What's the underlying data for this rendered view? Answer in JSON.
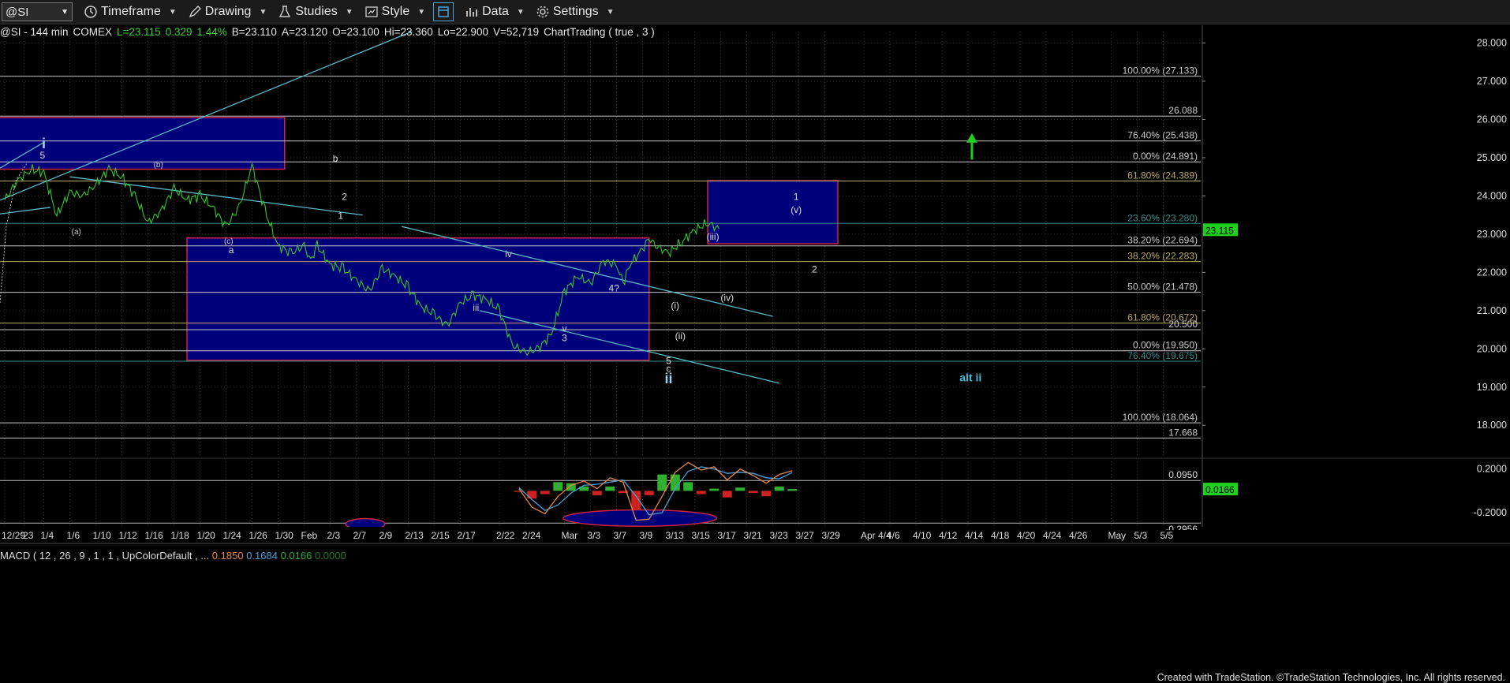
{
  "toolbar": {
    "symbol": "@SI",
    "timeframe": "Timeframe",
    "drawing": "Drawing",
    "studies": "Studies",
    "style": "Style",
    "data": "Data",
    "settings": "Settings"
  },
  "info_line": {
    "symbol": "@SI - 144 min",
    "exchange": "COMEX",
    "last": "L=23.115",
    "change": "0.329",
    "change_pct": "1.44%",
    "bid": "B=23.110",
    "ask": "A=23.120",
    "open": "O=23.100",
    "high": "Hi=23.360",
    "low": "Lo=22.900",
    "volume": "V=52,719",
    "chart_trading": "ChartTrading ( true , 3 )"
  },
  "macd_line": {
    "label": "MACD ( 12 , 26 , 9 , 1 , 1 , UpColorDefault , ...",
    "v1": "0.1850",
    "v2": "0.1684",
    "v3": "0.0166",
    "v4": "0.0000"
  },
  "footer": "Created with TradeStation. ©TradeStation Technologies, Inc. All rights reserved.",
  "colors": {
    "price": "#35c62f",
    "fib_gray": "#c8c8c8",
    "fib_olive": "#b9a86a",
    "box_fill": "#00007a",
    "box_border": "#cc2244",
    "channel": "#5ab8c8",
    "macd_orange": "#e4864a",
    "macd_blue": "#4aa0d8",
    "hist_green": "#30b030",
    "hist_red": "#cc2222",
    "accent_green": "#22cc22"
  },
  "chart_data": {
    "type": "line",
    "title": "@SI - 144 min COMEX",
    "price_axis": {
      "ylim": [
        17.2,
        28.3
      ],
      "ticks": [
        "28.000",
        "27.000",
        "26.000",
        "25.000",
        "24.000",
        "23.000",
        "22.000",
        "21.000",
        "20.000",
        "19.000",
        "18.000"
      ],
      "last_price_label": "23.115"
    },
    "x_axis": {
      "ticks": [
        "12/29",
        "'23",
        "1/4",
        "1/6",
        "1/10",
        "1/12",
        "1/16",
        "1/18",
        "1/20",
        "1/24",
        "1/26",
        "1/30",
        "Feb",
        "2/3",
        "2/7",
        "2/9",
        "2/13",
        "2/15",
        "2/17",
        "2/22",
        "2/24",
        "Mar",
        "3/3",
        "3/7",
        "3/9",
        "3/13",
        "3/15",
        "3/17",
        "3/21",
        "3/23",
        "3/27",
        "3/29",
        "Apr 4/4",
        "4/6",
        "4/10",
        "4/12",
        "4/14",
        "4/18",
        "4/20",
        "4/24",
        "4/26",
        "May",
        "5/3",
        "5/5"
      ],
      "tick_index": [
        0,
        1.5,
        3,
        5,
        7,
        9,
        11,
        13,
        15,
        17,
        19,
        21,
        23,
        25,
        27,
        29,
        31,
        33,
        35,
        38,
        40,
        43,
        45,
        47,
        49,
        51,
        53,
        55,
        57,
        59,
        61,
        63,
        66,
        68,
        70,
        72,
        74,
        76,
        78,
        80,
        82,
        85,
        87,
        89
      ]
    },
    "price_series": {
      "name": "@SI",
      "x": [
        0,
        1,
        2,
        3,
        4,
        5,
        6,
        7,
        8,
        9,
        10,
        11,
        12,
        13,
        14,
        15,
        16,
        17,
        18,
        19,
        20,
        21,
        22,
        23,
        23.5,
        24,
        25,
        26,
        27,
        28,
        29,
        30,
        31,
        32,
        33,
        34,
        35,
        36,
        37,
        38,
        39,
        40,
        41,
        42,
        43,
        44,
        45,
        46,
        47,
        47.5,
        48,
        49,
        49.5,
        50,
        51,
        52,
        53,
        54,
        55,
        56,
        57,
        58,
        59,
        59.5
      ],
      "y": [
        23.9,
        24.4,
        24.7,
        24.6,
        23.5,
        24.1,
        24.0,
        24.3,
        24.7,
        24.5,
        24.0,
        23.3,
        23.6,
        24.2,
        23.9,
        24.0,
        23.7,
        23.2,
        23.7,
        24.8,
        23.6,
        22.7,
        22.5,
        22.7,
        22.3,
        22.7,
        22.2,
        22.1,
        21.8,
        21.5,
        22.1,
        21.9,
        21.6,
        21.1,
        20.9,
        20.6,
        21.2,
        21.4,
        21.3,
        21.0,
        20.1,
        19.9,
        20.0,
        20.4,
        21.5,
        21.9,
        21.7,
        22.3,
        22.2,
        21.7,
        22.2,
        22.6,
        22.9,
        22.7,
        22.5,
        22.8,
        23.1,
        23.3,
        23.1
      ]
    },
    "fib_levels": [
      {
        "value": 27.133,
        "label": "100.00% (27.133)",
        "color": "#c8c8c8"
      },
      {
        "value": 26.088,
        "label": "26.088",
        "color": "#c8c8c8"
      },
      {
        "value": 25.438,
        "label": "76.40% (25.438)",
        "color": "#c8c8c8"
      },
      {
        "value": 24.891,
        "label": "0.00% (24.891)",
        "color": "#c8c8c8"
      },
      {
        "value": 24.389,
        "label": "61.80% (24.389)",
        "color": "#b9a86a"
      },
      {
        "value": 23.28,
        "label": "23.60% (23.280)",
        "color": "#3a8a8a"
      },
      {
        "value": 22.694,
        "label": "38.20% (22.694)",
        "color": "#c8c8c8"
      },
      {
        "value": 22.283,
        "label": "38.20% (22.283)",
        "color": "#b9a86a"
      },
      {
        "value": 21.478,
        "label": "50.00% (21.478)",
        "color": "#c8c8c8"
      },
      {
        "value": 20.672,
        "label": "61.80% (20.672)",
        "color": "#b9a86a"
      },
      {
        "value": 20.5,
        "label": "20.500",
        "color": "#c8c8c8"
      },
      {
        "value": 19.95,
        "label": "0.00% (19.950)",
        "color": "#c8c8c8"
      },
      {
        "value": 19.675,
        "label": "76.40% (19.675)",
        "color": "#3a8a8a"
      },
      {
        "value": 18.064,
        "label": "100.00% (18.064)",
        "color": "#c8c8c8"
      },
      {
        "value": 17.668,
        "label": "17.668",
        "color": "#c8c8c8"
      }
    ],
    "boxes": [
      {
        "x0": -1,
        "x1": 21.5,
        "y0": 24.7,
        "y1": 26.05
      },
      {
        "x0": 14,
        "x1": 49.5,
        "y0": 19.7,
        "y1": 22.9
      },
      {
        "x0": 54,
        "x1": 64,
        "y0": 22.75,
        "y1": 24.4
      }
    ],
    "trendlines": [
      {
        "x0": -1,
        "x1": 32,
        "y0": 23.8,
        "y1": 28.4
      },
      {
        "x0": -1,
        "x1": 3,
        "y0": 24.6,
        "y1": 25.4
      },
      {
        "x0": 5,
        "x1": 27.5,
        "y0": 24.5,
        "y1": 23.5
      },
      {
        "x0": 30.5,
        "x1": 59,
        "y0": 23.2,
        "y1": 20.85
      },
      {
        "x0": 36.5,
        "x1": 59.5,
        "y0": 21.0,
        "y1": 19.1
      },
      {
        "x0": -1,
        "x1": 3.5,
        "y0": 23.5,
        "y1": 23.7
      }
    ],
    "wave_labels": [
      {
        "text": "i",
        "x": 3,
        "y": 25.25,
        "color": "#9fd3f0",
        "size": 18,
        "bold": true
      },
      {
        "text": "5",
        "x": 2.9,
        "y": 24.98,
        "color": "#dddddd",
        "size": 12
      },
      {
        "text": "(a)",
        "x": 5.5,
        "y": 23.0,
        "color": "#cccccc",
        "size": 10
      },
      {
        "text": "(b)",
        "x": 11.8,
        "y": 24.75,
        "color": "#cccccc",
        "size": 10
      },
      {
        "text": "(c)",
        "x": 17.2,
        "y": 22.75,
        "color": "#cccccc",
        "size": 10
      },
      {
        "text": "a",
        "x": 17.4,
        "y": 22.5,
        "color": "#dddddd",
        "size": 12
      },
      {
        "text": "b",
        "x": 25.4,
        "y": 24.9,
        "color": "#dddddd",
        "size": 12
      },
      {
        "text": "2",
        "x": 26.1,
        "y": 23.9,
        "color": "#dddddd",
        "size": 12
      },
      {
        "text": "1",
        "x": 25.8,
        "y": 23.4,
        "color": "#dddddd",
        "size": 12
      },
      {
        "text": "iv",
        "x": 38.7,
        "y": 22.4,
        "color": "#cccccc",
        "size": 12
      },
      {
        "text": "iii",
        "x": 36.2,
        "y": 21.0,
        "color": "#cccccc",
        "size": 12
      },
      {
        "text": "4?",
        "x": 46.8,
        "y": 21.5,
        "color": "#dddddd",
        "size": 12
      },
      {
        "text": "v",
        "x": 43.0,
        "y": 20.45,
        "color": "#cccccc",
        "size": 12
      },
      {
        "text": "3",
        "x": 43.0,
        "y": 20.2,
        "color": "#dddddd",
        "size": 12
      },
      {
        "text": "5",
        "x": 51.0,
        "y": 19.6,
        "color": "#dddddd",
        "size": 12
      },
      {
        "text": "c",
        "x": 51.0,
        "y": 19.4,
        "color": "#dddddd",
        "size": 12
      },
      {
        "text": "ii",
        "x": 51.0,
        "y": 19.1,
        "color": "#9fd3f0",
        "size": 18,
        "bold": true
      },
      {
        "text": "(i)",
        "x": 51.5,
        "y": 21.05,
        "color": "#dddddd",
        "size": 12
      },
      {
        "text": "(ii)",
        "x": 51.9,
        "y": 20.25,
        "color": "#dddddd",
        "size": 12
      },
      {
        "text": "(iii)",
        "x": 54.4,
        "y": 22.85,
        "color": "#dddddd",
        "size": 12
      },
      {
        "text": "(iv)",
        "x": 55.5,
        "y": 21.25,
        "color": "#dddddd",
        "size": 12
      },
      {
        "text": "(v)",
        "x": 60.8,
        "y": 23.55,
        "color": "#dddddd",
        "size": 12
      },
      {
        "text": "1",
        "x": 60.8,
        "y": 23.9,
        "color": "#dddddd",
        "size": 12
      },
      {
        "text": "2",
        "x": 62.2,
        "y": 22.0,
        "color": "#dddddd",
        "size": 12
      },
      {
        "text": "alt ii",
        "x": 74.2,
        "y": 19.15,
        "color": "#33bfe0",
        "size": 14,
        "bold": true
      }
    ],
    "up_arrow": {
      "x": 74.3,
      "y_from": 24.95,
      "y_to": 25.6
    },
    "macd": {
      "ylim": [
        -0.33,
        0.27
      ],
      "ticks": [
        "0.2000",
        "-0.2000"
      ],
      "ref_levels": [
        {
          "value": 0.095,
          "label": "0.0950"
        },
        {
          "value": -0.2956,
          "label": "-0.2956"
        }
      ],
      "last_value_label": "0.0166",
      "macd": {
        "x": [
          39.5,
          40.5,
          41.5,
          42.5,
          43.5,
          44.5,
          45.5,
          46.5,
          47.5,
          48.5,
          49.5,
          50.5,
          51.5,
          52.5,
          53.5,
          54.5,
          55.5,
          56.5,
          57.5,
          58.5,
          59.5,
          60.5
        ],
        "y": [
          0.02,
          -0.15,
          -0.21,
          -0.05,
          0.05,
          0.09,
          0.02,
          0.12,
          0.08,
          -0.27,
          -0.26,
          -0.05,
          0.17,
          0.26,
          0.19,
          0.22,
          0.1,
          0.2,
          0.14,
          0.07,
          0.15,
          0.185
        ]
      },
      "signal": {
        "x": [
          39.5,
          40.5,
          41.5,
          42.5,
          43.5,
          44.5,
          45.5,
          46.5,
          47.5,
          48.5,
          49.5,
          50.5,
          51.5,
          52.5,
          53.5,
          54.5,
          55.5,
          56.5,
          57.5,
          58.5,
          59.5,
          60.5
        ],
        "y": [
          0.03,
          -0.08,
          -0.18,
          -0.13,
          -0.02,
          0.05,
          0.06,
          0.08,
          0.1,
          -0.05,
          -0.22,
          -0.2,
          0.02,
          0.18,
          0.22,
          0.2,
          0.16,
          0.17,
          0.16,
          0.12,
          0.11,
          0.168
        ]
      },
      "histogram": {
        "x": [
          39.5,
          40.5,
          41.5,
          42.5,
          43.5,
          44.5,
          45.5,
          46.5,
          47.5,
          48.5,
          49.5,
          50.5,
          51.5,
          52.5,
          53.5,
          54.5,
          55.5,
          56.5,
          57.5,
          58.5,
          59.5,
          60.5
        ],
        "y": [
          -0.01,
          -0.07,
          -0.03,
          0.08,
          0.07,
          0.04,
          -0.04,
          0.04,
          -0.02,
          -0.22,
          -0.04,
          0.15,
          0.15,
          0.08,
          -0.03,
          0.02,
          -0.06,
          0.03,
          -0.02,
          -0.05,
          0.04,
          0.0166
        ]
      },
      "ellipses": [
        {
          "cx": 27.7,
          "cy": -0.305,
          "rx": 1.5,
          "ry": 0.05
        },
        {
          "cx": 48.8,
          "cy": -0.25,
          "rx": 5.9,
          "ry": 0.075
        }
      ]
    }
  }
}
